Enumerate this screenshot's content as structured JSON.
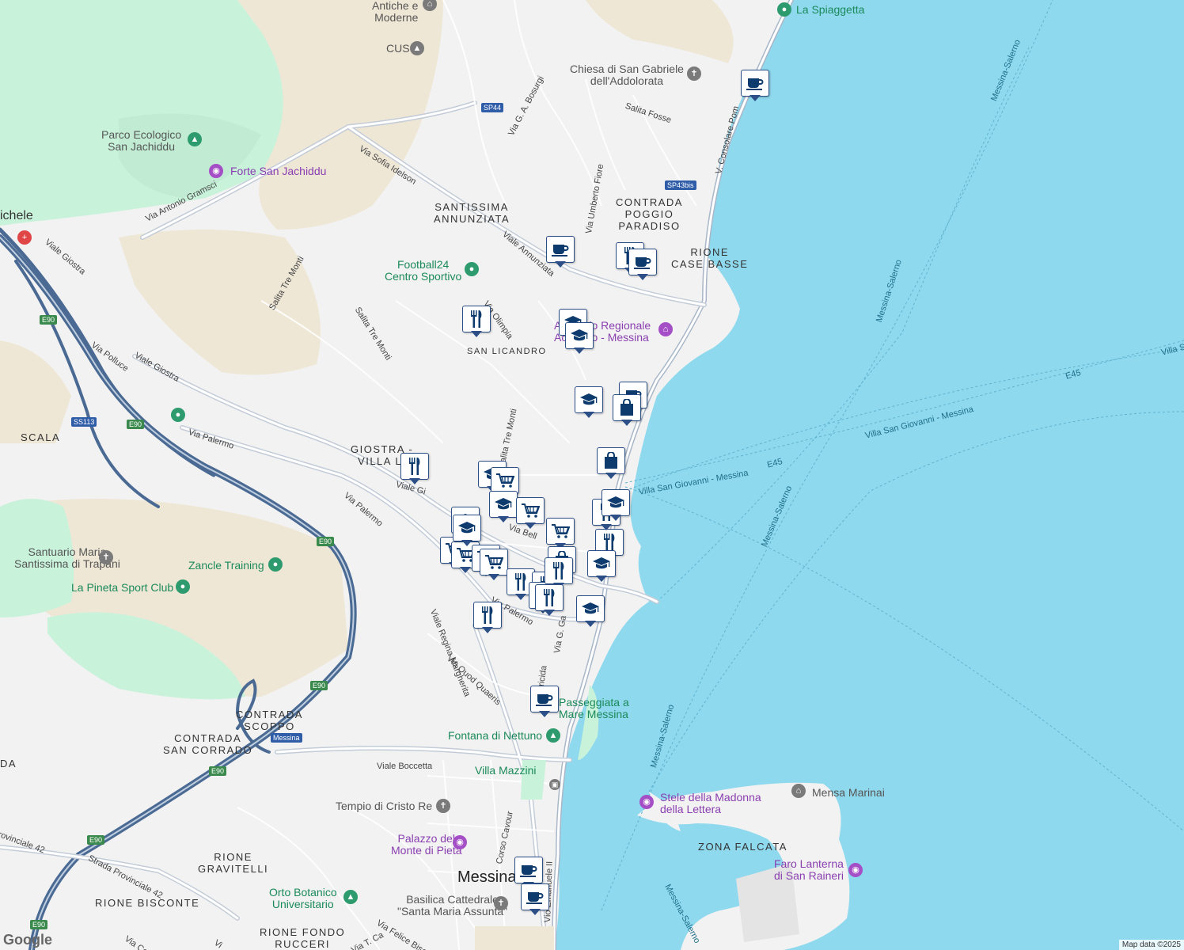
{
  "map": {
    "attribution": "Map data ©2025",
    "logo": "Google",
    "colors": {
      "sea": "#8fd9ee",
      "land": "#f2f2f2",
      "park": "#c9f2db",
      "sand": "#efe7d6",
      "highway": "#4a6a93",
      "road": "#ffffff",
      "marker_blue": "#2b4f86"
    }
  },
  "areas": [
    {
      "text": "SANTISSIMA\nANNUNZIATA"
    },
    {
      "text": "CONTRADA\nPOGGIO\nPARADISO"
    },
    {
      "text": "RIONE\nCASE BASSE"
    },
    {
      "text": "SAN LICANDRO"
    },
    {
      "text": "GIOSTRA -\nVILLA LI"
    },
    {
      "text": "SCALA"
    },
    {
      "text": "CONTRADA\nSCOPPO"
    },
    {
      "text": "CONTRADA\nSAN CORRADO"
    },
    {
      "text": "RIONE\nGRAVITELLI"
    },
    {
      "text": "RIONE BISCONTE"
    },
    {
      "text": "RIONE FONDO\nRUCCERI"
    },
    {
      "text": "ZONA FALCATA"
    },
    {
      "text": "ichele"
    },
    {
      "text": "DA"
    }
  ],
  "city": "Messina",
  "streets": [
    "Via Antonio Gramsci",
    "Viale Giostra",
    "Via Palermo",
    "Viale Giostra",
    "Via Polluce",
    "Via Sofia Idelson",
    "Viale Annunziata",
    "Via Olimpia",
    "Salita Tre Monti",
    "Salita Tre Monti",
    "Salita Tre Monti",
    "Via G. A. Bosurgi",
    "Via Umberto Fiore",
    "Salita Fosse",
    "V. Consolare Pom",
    "Viale Regina Margherita",
    "Via Quod Quaeris",
    "Via G. Ga",
    "Viale Boccetta",
    "Strada Provinciale 42",
    "rovinciale 42",
    "Corso Cavour",
    "Vio Emanuele II",
    "Via Felice Bisa",
    "Via T. Ca",
    "Via Palermo",
    "Viale Gi",
    "Via Palermo",
    "Via Co",
    "ricida",
    "Via Bell",
    "Vi"
  ],
  "sea_labels": [
    "Messina-Salerno",
    "Messina-Salerno",
    "Messina-Salerno",
    "Messina-Salerno",
    "Messina-Salerno",
    "Villa San Giovanni - Messina",
    "Villa San Giovanni - Messina",
    "E45",
    "E45",
    "Villa S"
  ],
  "shields": [
    "SP44",
    "SP43bis",
    "E90",
    "E90",
    "E90",
    "E90",
    "E90",
    "SS113",
    "E90",
    "Messina"
  ],
  "pois": [
    {
      "text": "Antiche e\nModerne",
      "icon": "museum-icon",
      "color": "grey"
    },
    {
      "text": "CUS",
      "icon": "school-icon",
      "color": "grey"
    },
    {
      "text": "La Spiaggetta",
      "icon": "beach-icon",
      "color": "green"
    },
    {
      "text": "Chiesa di San Gabriele\ndell'Addolorata",
      "icon": "church-icon",
      "color": "grey"
    },
    {
      "text": "Parco Ecologico\nSan Jachiddu",
      "icon": "park-icon",
      "color": "green"
    },
    {
      "text": "Forte San Jachiddu",
      "icon": "camera-icon",
      "color": "purple"
    },
    {
      "text": "Football24\nCentro Sportivo",
      "icon": "sport-icon",
      "color": "green"
    },
    {
      "text": "Acquario Regionale\nAcquario - Messina",
      "icon": "museum-icon",
      "color": "purple"
    },
    {
      "text": "Santuario Maria\nSantissima di Trapani",
      "icon": "church-icon",
      "color": "grey"
    },
    {
      "text": "Zancle Training",
      "icon": "sport-icon",
      "color": "green"
    },
    {
      "text": "La Pineta Sport Club",
      "icon": "sport-icon",
      "color": "green"
    },
    {
      "text": "Passeggiata a\nMare Messina",
      "icon": "walk-icon",
      "color": "green"
    },
    {
      "text": "Fontana di Nettuno",
      "icon": "park-icon",
      "color": "green"
    },
    {
      "text": "Villa Mazzini",
      "icon": "park-icon",
      "color": "green"
    },
    {
      "text": "Stele della Madonna\ndella Lettera",
      "icon": "camera-icon",
      "color": "purple"
    },
    {
      "text": "Mensa Marinai",
      "icon": "museum-icon",
      "color": "grey"
    },
    {
      "text": "Tempio di Cristo Re",
      "icon": "church-icon",
      "color": "grey"
    },
    {
      "text": "Palazzo del\nMonte di Pietà",
      "icon": "camera-icon",
      "color": "purple"
    },
    {
      "text": "Orto Botanico\nUniversitario",
      "icon": "park-icon",
      "color": "green"
    },
    {
      "text": "Basilica Cattedrale\n\"Santa Maria Assunta\"",
      "icon": "church-icon",
      "color": "grey"
    },
    {
      "text": "Faro Lanterna\ndi San Raineri",
      "icon": "camera-icon",
      "color": "purple"
    }
  ],
  "markers": [
    {
      "type": "cafe"
    },
    {
      "type": "cafe"
    },
    {
      "type": "restaurant"
    },
    {
      "type": "cafe"
    },
    {
      "type": "restaurant"
    },
    {
      "type": "school"
    },
    {
      "type": "school"
    },
    {
      "type": "school"
    },
    {
      "type": "cafe"
    },
    {
      "type": "shop"
    },
    {
      "type": "shop"
    },
    {
      "type": "restaurant"
    },
    {
      "type": "school"
    },
    {
      "type": "grocery"
    },
    {
      "type": "school"
    },
    {
      "type": "grocery"
    },
    {
      "type": "school"
    },
    {
      "type": "grocery"
    },
    {
      "type": "grocery"
    },
    {
      "type": "grocery"
    },
    {
      "type": "grocery"
    },
    {
      "type": "grocery"
    },
    {
      "type": "shop"
    },
    {
      "type": "restaurant"
    },
    {
      "type": "restaurant"
    },
    {
      "type": "restaurant"
    },
    {
      "type": "restaurant"
    },
    {
      "type": "restaurant"
    },
    {
      "type": "school"
    },
    {
      "type": "restaurant"
    },
    {
      "type": "restaurant"
    },
    {
      "type": "school"
    },
    {
      "type": "school"
    },
    {
      "type": "restaurant"
    },
    {
      "type": "school"
    },
    {
      "type": "cafe"
    },
    {
      "type": "cafe"
    },
    {
      "type": "cafe"
    }
  ]
}
